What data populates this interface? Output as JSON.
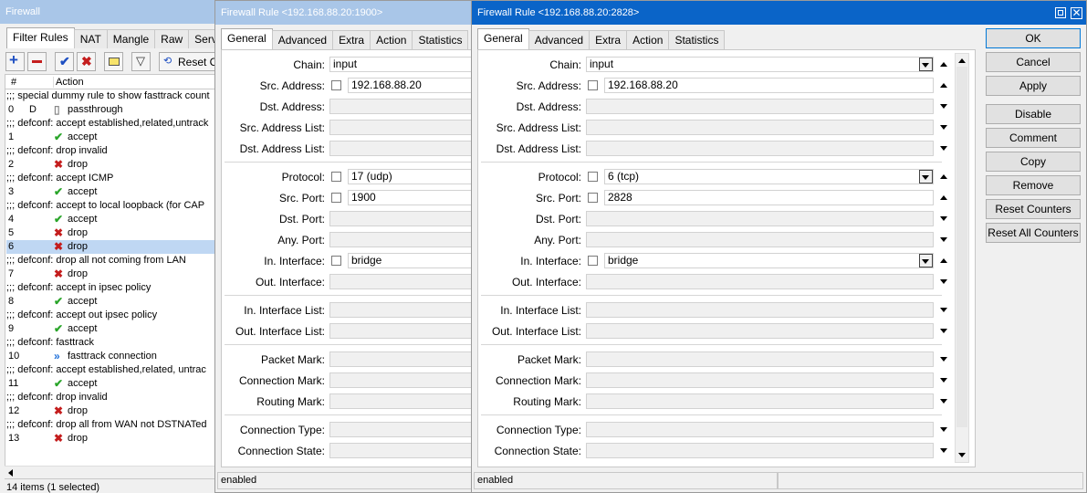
{
  "firewall": {
    "title": "Firewall",
    "tabs": [
      "Filter Rules",
      "NAT",
      "Mangle",
      "Raw",
      "Service"
    ],
    "reset_label": "Reset Co",
    "col_num": "#",
    "col_action": "Action",
    "rows": [
      {
        "num": "",
        "comment": ";;; special dummy rule to show fasttrack count"
      },
      {
        "num": "0",
        "flag": "D",
        "icon": "doc-icon",
        "action": "passthrough"
      },
      {
        "num": "",
        "comment": ";;; defconf: accept established,related,untrack"
      },
      {
        "num": "1",
        "icon": "accept-icon",
        "action": "accept"
      },
      {
        "num": "",
        "comment": ";;; defconf: drop invalid"
      },
      {
        "num": "2",
        "icon": "drop-icon",
        "action": "drop"
      },
      {
        "num": "",
        "comment": ";;; defconf: accept ICMP"
      },
      {
        "num": "3",
        "icon": "accept-icon",
        "action": "accept"
      },
      {
        "num": "",
        "comment": ";;; defconf: accept to local loopback (for CAP"
      },
      {
        "num": "4",
        "icon": "accept-icon",
        "action": "accept"
      },
      {
        "num": "5",
        "icon": "drop-icon",
        "action": "drop"
      },
      {
        "num": "6",
        "icon": "drop-icon",
        "action": "drop",
        "selected": true
      },
      {
        "num": "",
        "comment": ";;; defconf: drop all not coming from LAN"
      },
      {
        "num": "7",
        "icon": "drop-icon",
        "action": "drop"
      },
      {
        "num": "",
        "comment": ";;; defconf: accept in ipsec policy"
      },
      {
        "num": "8",
        "icon": "accept-icon",
        "action": "accept"
      },
      {
        "num": "",
        "comment": ";;; defconf: accept out ipsec policy"
      },
      {
        "num": "9",
        "icon": "accept-icon",
        "action": "accept"
      },
      {
        "num": "",
        "comment": ";;; defconf: fasttrack"
      },
      {
        "num": "10",
        "icon": "fasttrack-icon",
        "action": "fasttrack connection"
      },
      {
        "num": "",
        "comment": ";;; defconf: accept established,related, untrac"
      },
      {
        "num": "11",
        "icon": "accept-icon",
        "action": "accept"
      },
      {
        "num": "",
        "comment": ";;; defconf: drop invalid"
      },
      {
        "num": "12",
        "icon": "drop-icon",
        "action": "drop"
      },
      {
        "num": "",
        "comment": ";;; defconf: drop all from WAN not DSTNATed"
      },
      {
        "num": "13",
        "icon": "drop-icon",
        "action": "drop"
      }
    ],
    "status": "14 items (1 selected)"
  },
  "rule1": {
    "title": "Firewall Rule <192.168.88.20:1900>",
    "tabs": [
      "General",
      "Advanced",
      "Extra",
      "Action",
      "Statistics"
    ],
    "status": "enabled",
    "fields": [
      {
        "label": "Chain:",
        "value": "input"
      },
      {
        "label": "Src. Address:",
        "value": "192.168.88.20"
      },
      {
        "label": "Dst. Address:",
        "value": ""
      },
      {
        "label": "Src. Address List:",
        "value": ""
      },
      {
        "label": "Dst. Address List:",
        "value": ""
      },
      {
        "label": "Protocol:",
        "value": "17 (udp)"
      },
      {
        "label": "Src. Port:",
        "value": "1900"
      },
      {
        "label": "Dst. Port:",
        "value": ""
      },
      {
        "label": "Any. Port:",
        "value": ""
      },
      {
        "label": "In. Interface:",
        "value": "bridge"
      },
      {
        "label": "Out. Interface:",
        "value": ""
      },
      {
        "label": "In. Interface List:",
        "value": ""
      },
      {
        "label": "Out. Interface List:",
        "value": ""
      },
      {
        "label": "Packet Mark:",
        "value": ""
      },
      {
        "label": "Connection Mark:",
        "value": ""
      },
      {
        "label": "Routing Mark:",
        "value": ""
      },
      {
        "label": "Connection Type:",
        "value": ""
      },
      {
        "label": "Connection State:",
        "value": ""
      }
    ]
  },
  "rule2": {
    "title": "Firewall Rule <192.168.88.20:2828>",
    "tabs": [
      "General",
      "Advanced",
      "Extra",
      "Action",
      "Statistics"
    ],
    "status": "enabled",
    "fields": [
      {
        "label": "Chain:",
        "value": "input"
      },
      {
        "label": "Src. Address:",
        "value": "192.168.88.20"
      },
      {
        "label": "Dst. Address:",
        "value": ""
      },
      {
        "label": "Src. Address List:",
        "value": ""
      },
      {
        "label": "Dst. Address List:",
        "value": ""
      },
      {
        "label": "Protocol:",
        "value": "6 (tcp)"
      },
      {
        "label": "Src. Port:",
        "value": "2828"
      },
      {
        "label": "Dst. Port:",
        "value": ""
      },
      {
        "label": "Any. Port:",
        "value": ""
      },
      {
        "label": "In. Interface:",
        "value": "bridge"
      },
      {
        "label": "Out. Interface:",
        "value": ""
      },
      {
        "label": "In. Interface List:",
        "value": ""
      },
      {
        "label": "Out. Interface List:",
        "value": ""
      },
      {
        "label": "Packet Mark:",
        "value": ""
      },
      {
        "label": "Connection Mark:",
        "value": ""
      },
      {
        "label": "Routing Mark:",
        "value": ""
      },
      {
        "label": "Connection Type:",
        "value": ""
      },
      {
        "label": "Connection State:",
        "value": ""
      }
    ],
    "buttons": [
      "OK",
      "Cancel",
      "Apply",
      "Disable",
      "Comment",
      "Copy",
      "Remove",
      "Reset Counters",
      "Reset All Counters"
    ]
  }
}
